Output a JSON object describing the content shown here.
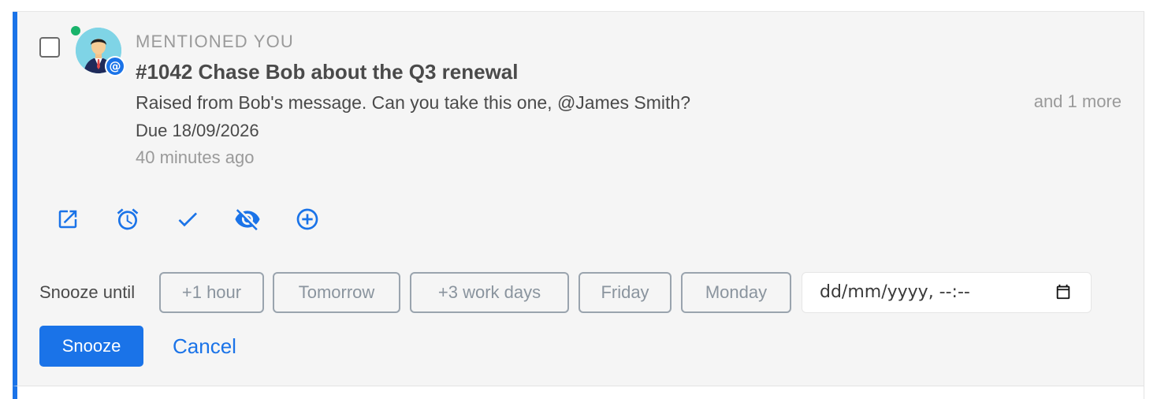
{
  "notification": {
    "category": "MENTIONED YOU",
    "title": "#1042 Chase Bob about the Q3 renewal",
    "description": "Raised from Bob's message. Can you take this one, @James Smith?",
    "due": "Due 18/09/2026",
    "time_ago": "40 minutes ago",
    "more": "and 1 more",
    "mention_badge": "@",
    "selected": false,
    "presence": "online"
  },
  "actions": [
    {
      "icon": "open-external-icon"
    },
    {
      "icon": "alarm-clock-icon"
    },
    {
      "icon": "checkmark-icon"
    },
    {
      "icon": "eye-off-icon"
    },
    {
      "icon": "plus-circle-icon"
    }
  ],
  "snooze": {
    "label": "Snooze until",
    "options": [
      "+1 hour",
      "Tomorrow",
      "+3 work days",
      "Friday",
      "Monday"
    ],
    "datetime_placeholder": "dd/mm/yyyy, --:--",
    "submit_label": "Snooze",
    "cancel_label": "Cancel"
  },
  "colors": {
    "accent": "#1a73e8",
    "presence_online": "#19b36b",
    "row_background": "#f5f5f5"
  }
}
